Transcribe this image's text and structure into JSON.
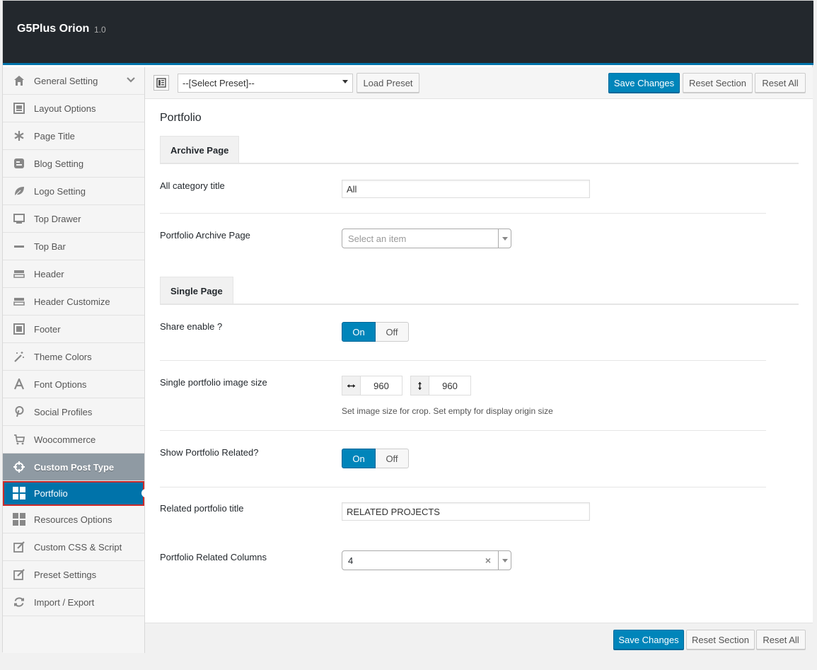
{
  "app": {
    "title": "G5Plus Orion",
    "version": "1.0"
  },
  "sidebar": {
    "items": [
      {
        "label": "General Setting",
        "icon": "home-icon"
      },
      {
        "label": "Layout Options",
        "icon": "layout-icon"
      },
      {
        "label": "Page Title",
        "icon": "asterisk-icon"
      },
      {
        "label": "Blog Setting",
        "icon": "blogger-icon"
      },
      {
        "label": "Logo Setting",
        "icon": "leaf-icon"
      },
      {
        "label": "Top Drawer",
        "icon": "monitor-icon"
      },
      {
        "label": "Top Bar",
        "icon": "minus-icon"
      },
      {
        "label": "Header",
        "icon": "header-icon"
      },
      {
        "label": "Header Customize",
        "icon": "header-icon"
      },
      {
        "label": "Footer",
        "icon": "footer-icon"
      },
      {
        "label": "Theme Colors",
        "icon": "magic-wand-icon"
      },
      {
        "label": "Font Options",
        "icon": "font-icon"
      },
      {
        "label": "Social Profiles",
        "icon": "pinterest-icon"
      },
      {
        "label": "Woocommerce",
        "icon": "cart-icon"
      },
      {
        "label": "Custom Post Type",
        "icon": "crosshair-icon"
      },
      {
        "label": "Portfolio",
        "icon": "grid-icon"
      },
      {
        "label": "Resources Options",
        "icon": "grid-icon"
      },
      {
        "label": "Custom CSS & Script",
        "icon": "edit-icon"
      },
      {
        "label": "Preset Settings",
        "icon": "edit-icon"
      },
      {
        "label": "Import / Export",
        "icon": "refresh-icon"
      }
    ]
  },
  "toolbar": {
    "preset_value": "--[Select Preset]--",
    "load_preset": "Load Preset",
    "save_changes": "Save Changes",
    "reset_section": "Reset Section",
    "reset_all": "Reset All"
  },
  "main": {
    "section_title": "Portfolio",
    "archive_tab": "Archive Page",
    "single_tab": "Single Page",
    "fields": {
      "all_category_title": {
        "label": "All category title",
        "value": "All"
      },
      "portfolio_archive_page": {
        "label": "Portfolio Archive Page",
        "placeholder": "Select an item"
      },
      "share_enable": {
        "label": "Share enable ?",
        "on": "On",
        "off": "Off"
      },
      "image_size": {
        "label": "Single portfolio image size",
        "width": "960",
        "height": "960",
        "hint": "Set image size for crop. Set empty for display origin size"
      },
      "show_related": {
        "label": "Show Portfolio Related?",
        "on": "On",
        "off": "Off"
      },
      "related_title": {
        "label": "Related portfolio title",
        "value": "RELATED PROJECTS"
      },
      "related_columns": {
        "label": "Portfolio Related Columns",
        "value": "4",
        "clear": "×"
      }
    }
  },
  "footer": {
    "save_changes": "Save Changes",
    "reset_section": "Reset Section",
    "reset_all": "Reset All"
  },
  "colors": {
    "accent": "#0085ba",
    "header_bg": "#23282d",
    "active_outline": "#cc2b2b"
  }
}
